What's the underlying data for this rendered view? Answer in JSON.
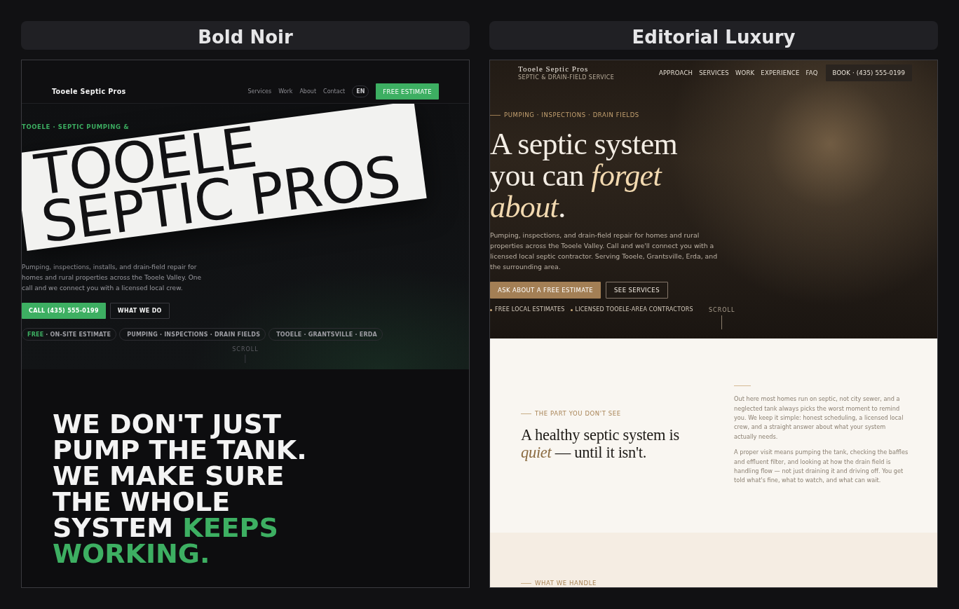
{
  "panels": [
    {
      "kind": "noir",
      "title": "Bold Noir",
      "nav": {
        "brand": "Tooele Septic Pros",
        "links": [
          "Services",
          "Work",
          "About",
          "Contact"
        ],
        "language": "EN",
        "cta": "FREE ESTIMATE"
      },
      "hero": {
        "eyebrow": "TOOELE · SEPTIC PUMPING &",
        "headline": "TOOELE SEPTIC PROS",
        "description": "Pumping, inspections, installs, and drain-field repair for homes and rural properties across the Tooele Valley. One call and we connect you with a licensed local crew.",
        "buttons": [
          {
            "label": "CALL (435) 555-0199",
            "kind": "primary"
          },
          {
            "label": "WHAT WE DO",
            "kind": "outline"
          }
        ],
        "tags": [
          {
            "accent": "FREE",
            "text": "· ON-SITE ESTIMATE"
          },
          {
            "text": "PUMPING · INSPECTIONS · DRAIN FIELDS"
          },
          {
            "text": "TOOELE · GRANTSVILLE · ERDA"
          }
        ],
        "scroll_label": "SCROLL"
      },
      "statement": {
        "text": "WE DON'T JUST PUMP THE TANK. WE MAKE SURE THE WHOLE SYSTEM",
        "accent": "KEEPS WORKING."
      }
    },
    {
      "kind": "editorial",
      "title": "Editorial Luxury",
      "nav": {
        "brand": "Tooele Septic Pros",
        "tagline": "SEPTIC & DRAIN-FIELD SERVICE",
        "links": [
          "APPROACH",
          "SERVICES",
          "WORK",
          "EXPERIENCE",
          "FAQ"
        ],
        "cta": "BOOK · (435) 555-0199"
      },
      "hero": {
        "eyebrow": "PUMPING · INSPECTIONS · DRAIN FIELDS",
        "headline": "A septic system you can *forget about*.",
        "description": "Pumping, inspections, and drain-field repair for homes and rural properties across the Tooele Valley. Call and we'll connect you with a licensed local septic contractor. Serving Tooele, Grantsville, Erda, and the surrounding area.",
        "buttons": [
          {
            "label": "ASK ABOUT A FREE ESTIMATE",
            "kind": "primary"
          },
          {
            "label": "SEE SERVICES",
            "kind": "outline"
          }
        ],
        "features": [
          "FREE LOCAL ESTIMATES",
          "LICENSED TOOELE-AREA CONTRACTORS"
        ],
        "scroll_label": "SCROLL"
      },
      "intro": {
        "eyebrow": "THE PART YOU DON'T SEE",
        "headline": "A healthy septic system is *quiet* — until it isn't.",
        "paragraphs": [
          "Out here most homes run on septic, not city sewer, and a neglected tank always picks the worst moment to remind you. We keep it simple: honest scheduling, a licensed local crew, and a straight answer about what your system actually needs.",
          "A proper visit means pumping the tank, checking the baffles and effluent filter, and looking at how the drain field is handling flow — not just draining it and driving off. You get told what's fine, what to watch, and what can wait."
        ]
      },
      "next_section": {
        "eyebrow": "WHAT WE HANDLE"
      }
    }
  ]
}
